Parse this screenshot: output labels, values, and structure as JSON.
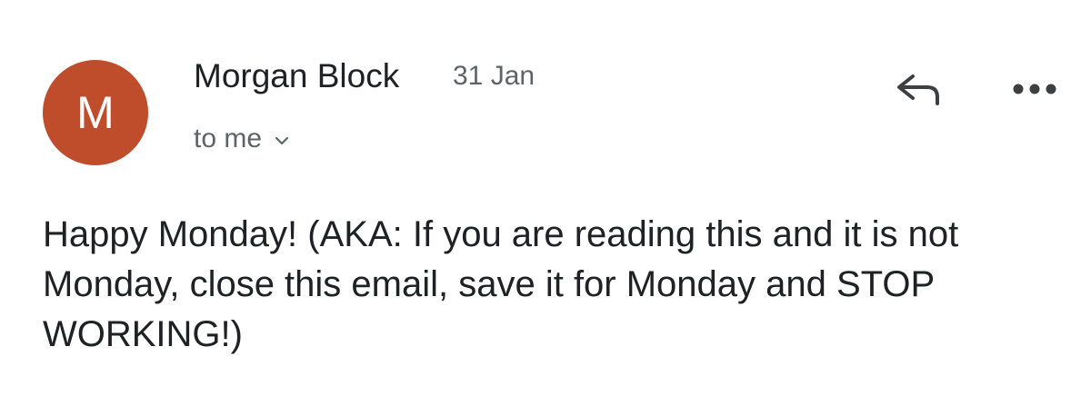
{
  "sender": {
    "initial": "M",
    "name": "Morgan Block",
    "date": "31 Jan",
    "avatar_color": "#bf4d2c"
  },
  "recipient": {
    "label": "to me",
    "expand_icon": "chevron-down-icon"
  },
  "actions": {
    "reply_icon": "reply-icon",
    "more_icon": "more-options-icon"
  },
  "body": {
    "text": "Happy Monday! (AKA: If you are reading this and it is not Monday, close this email, save it for Monday and STOP WORKING!)"
  }
}
